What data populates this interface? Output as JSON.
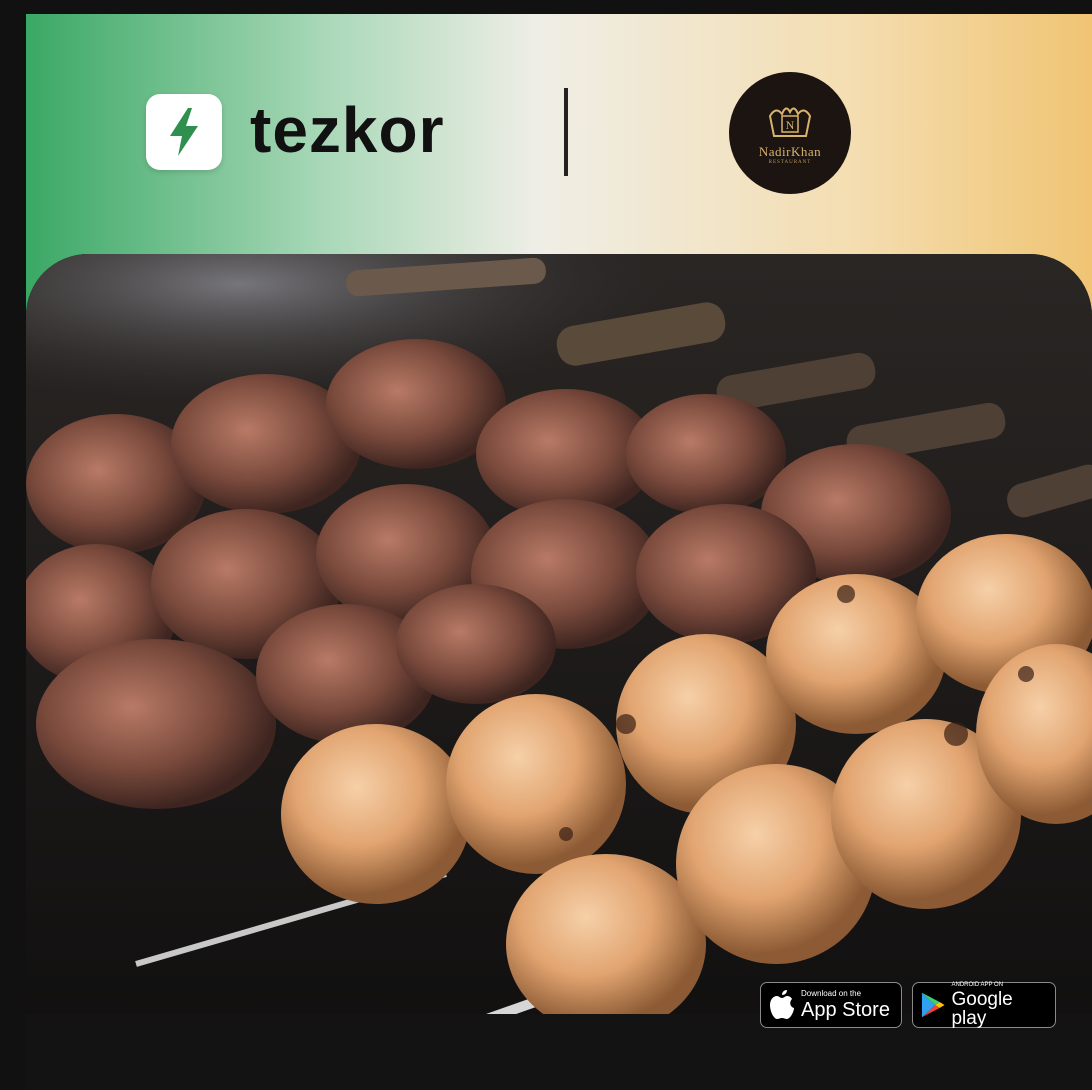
{
  "header": {
    "brand_name": "tezkor",
    "app_icon": "lightning-bolt-icon",
    "partner": {
      "initial": "N",
      "name": "NadirKhan",
      "subtitle": "RESTAURANT"
    }
  },
  "photo": {
    "subject": "grilled-kebab-skewers"
  },
  "store_badges": {
    "app_store": {
      "top_line": "Download on the",
      "label": "App Store",
      "icon": "apple-icon"
    },
    "google_play": {
      "top_line": "ANDROID APP ON",
      "label": "Google play",
      "icon": "google-play-icon"
    }
  },
  "colors": {
    "brand_green": "#2f8f4e",
    "gradient_left": "#3aa865",
    "gradient_right": "#f0c473",
    "partner_gold": "#d9b36b"
  }
}
